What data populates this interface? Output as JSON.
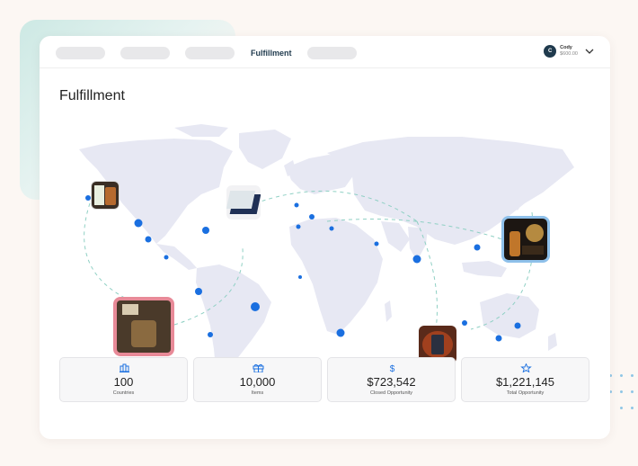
{
  "nav": {
    "active_label": "Fulfillment",
    "user": {
      "initial": "C",
      "name": "Cody",
      "balance": "$600.00"
    }
  },
  "page": {
    "title": "Fulfillment"
  },
  "map": {
    "land_color": "#e7e8f3",
    "marker_color": "#1a6fe0",
    "route_color": "#8fd0c4"
  },
  "stats": [
    {
      "icon": "buildings-icon",
      "value": "100",
      "label": "Countries"
    },
    {
      "icon": "gift-icon",
      "value": "10,000",
      "label": "Items"
    },
    {
      "icon": "dollar-icon",
      "value": "$723,542",
      "label": "Closed Opportunity"
    },
    {
      "icon": "star-icon",
      "value": "$1,221,145",
      "label": "Total Opportunity"
    }
  ]
}
